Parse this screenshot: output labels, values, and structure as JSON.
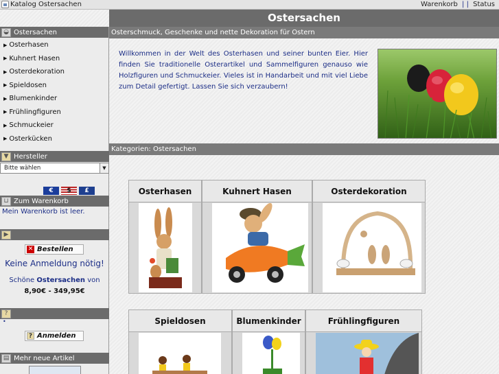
{
  "topbar": {
    "home_label": "Katalog Ostersachen",
    "cart_link": "Warenkorb",
    "separator": "| |",
    "status_link": "Status"
  },
  "header": {
    "title": "Ostersachen",
    "subtitle": "Osterschmuck, Geschenke und nette Dekoration für Ostern"
  },
  "sidebar": {
    "categories_title": "Ostersachen",
    "categories": [
      "Osterhasen",
      "Kuhnert Hasen",
      "Osterdekoration",
      "Spieldosen",
      "Blumenkinder",
      "Frühlingfiguren",
      "Schmuckeier",
      "Osterkücken"
    ],
    "manufacturer_title": "Hersteller",
    "manufacturer_select": "Bitte wählen",
    "currencies": [
      "€",
      "$",
      "£"
    ],
    "cart_title": "Zum Warenkorb",
    "cart_text": "Mein Warenkorb ist leer.",
    "order_button": "Bestellen",
    "no_login": "Keine Anmeldung nötig!",
    "price_intro": "Schöne",
    "price_bold": "Ostersachen",
    "price_suffix": "von",
    "price_range": "8,90€ - 349,95€",
    "dot": "•",
    "login_button": "Anmelden",
    "new_items_title": "Mehr neue Artikel"
  },
  "main": {
    "welcome": "Willkommen in der Welt des Osterhasen und seiner bunten Eier. Hier finden Sie traditionelle Osterartikel und Sammelfiguren genauso wie Holzfiguren und Schmuckeier. Vieles ist in Handarbeit und mit viel Liebe zum Detail gefertigt. Lassen Sie sich verzaubern!",
    "categories_bar": "Kategorien: Ostersachen",
    "row1": [
      "Osterhasen",
      "Kuhnert Hasen",
      "Osterdekoration"
    ],
    "row2": [
      "Spieldosen",
      "Blumenkinder",
      "Frühlingfiguren"
    ]
  },
  "colors": {
    "header_bg": "#6b6b6b",
    "link_blue": "#1b2d86"
  }
}
